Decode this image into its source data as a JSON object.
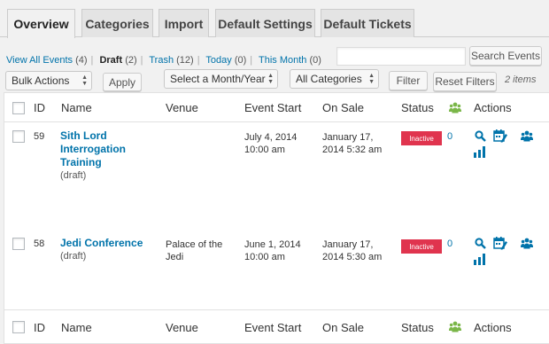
{
  "tabs": [
    {
      "label": "Overview",
      "active": true
    },
    {
      "label": "Categories"
    },
    {
      "label": "Import"
    },
    {
      "label": "Default Settings"
    },
    {
      "label": "Default Tickets"
    }
  ],
  "views": {
    "all_label": "View All Events",
    "all_count": "(4)",
    "draft_label": "Draft",
    "draft_count": "(2)",
    "trash_label": "Trash",
    "trash_count": "(12)",
    "today_label": "Today",
    "today_count": "(0)",
    "month_label": "This Month",
    "month_count": "(0)"
  },
  "search": {
    "button": "Search Events",
    "value": ""
  },
  "filters": {
    "bulk_actions": "Bulk Actions",
    "apply": "Apply",
    "month": "Select a Month/Year",
    "categories": "All Categories",
    "filter": "Filter",
    "reset": "Reset Filters",
    "count": "2 items"
  },
  "columns": {
    "id": "ID",
    "name": "Name",
    "venue": "Venue",
    "start": "Event Start",
    "on_sale": "On Sale",
    "status": "Status",
    "actions": "Actions"
  },
  "rows": [
    {
      "id": "59",
      "name_lines": [
        "Sith Lord",
        "Interrogation",
        "Training"
      ],
      "state": "(draft)",
      "venue_lines": [
        "",
        ""
      ],
      "start_lines": [
        "July 4, 2014",
        "10:00 am"
      ],
      "sale_lines": [
        "January 17,",
        "2014 5:32 am"
      ],
      "status": "Inactive",
      "attendees": "0"
    },
    {
      "id": "58",
      "name_lines": [
        "Jedi Conference",
        "",
        ""
      ],
      "state": "(draft)",
      "venue_lines": [
        "Palace of the",
        "Jedi"
      ],
      "start_lines": [
        "June 1, 2014",
        "10:00 am"
      ],
      "sale_lines": [
        "January 17,",
        "2014 5:30 am"
      ],
      "status": "Inactive",
      "attendees": "0"
    }
  ],
  "colors": {
    "accent": "#0073aa",
    "inactive": "#e0344e",
    "attendee_icon": "#7ab648"
  }
}
